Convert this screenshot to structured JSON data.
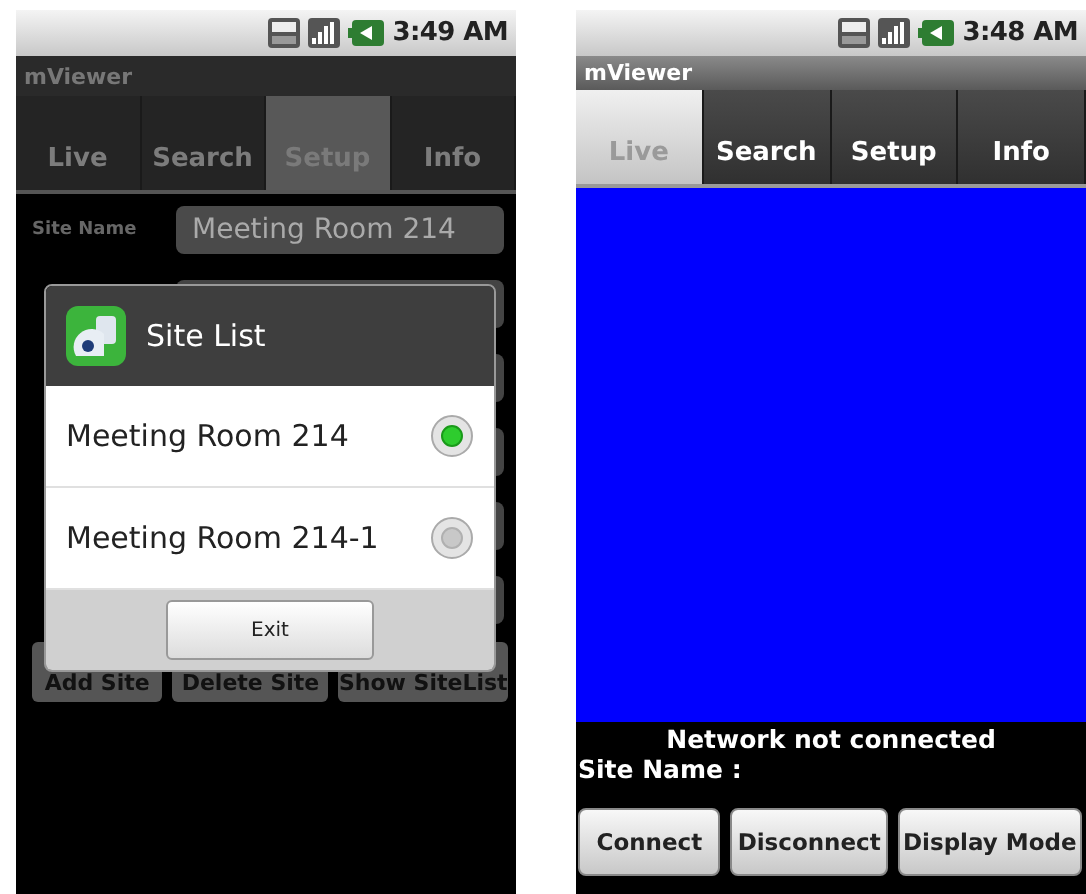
{
  "setup_screen": {
    "status_bar": {
      "time": "3:49 AM"
    },
    "app_title": "mViewer",
    "tabs": [
      {
        "label": "Live",
        "selected": false
      },
      {
        "label": "Search",
        "selected": false
      },
      {
        "label": "Setup",
        "selected": true
      },
      {
        "label": "Info",
        "selected": false
      }
    ],
    "site_name_label": "Site Name",
    "site_name_value": "Meeting Room 214",
    "buttons": [
      "Add Site",
      "Delete Site",
      "Show SiteList"
    ],
    "dialog": {
      "title": "Site List",
      "items": [
        {
          "label": "Meeting Room 214",
          "selected": true
        },
        {
          "label": "Meeting Room 214-1",
          "selected": false
        }
      ],
      "button": "Exit"
    }
  },
  "live_screen": {
    "status_bar": {
      "time": "3:48 AM"
    },
    "app_title": "mViewer",
    "tabs": [
      {
        "label": "Live",
        "selected": true
      },
      {
        "label": "Search",
        "selected": false
      },
      {
        "label": "Setup",
        "selected": false
      },
      {
        "label": "Info",
        "selected": false
      }
    ],
    "network_status": "Network not connected",
    "site_name_label": "Site Name :",
    "buttons": [
      "Connect",
      "Disconnect",
      "Display Mode"
    ]
  }
}
